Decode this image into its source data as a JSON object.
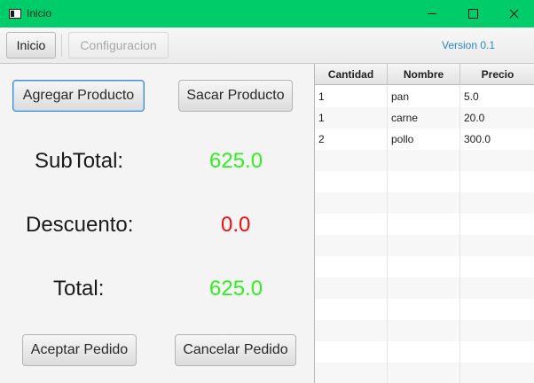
{
  "window": {
    "title": "Inicio",
    "icons": {
      "app": "window-icon",
      "minimize": "minimize-icon",
      "maximize": "maximize-icon",
      "close": "close-icon"
    },
    "title_bar_color": "#00cc6a"
  },
  "toolbar": {
    "inicio_label": "Inicio",
    "configuracion_label": "Configuracion",
    "version": "Version 0.1"
  },
  "actions": {
    "agregar": "Agregar Producto",
    "sacar": "Sacar Producto",
    "aceptar": "Aceptar Pedido",
    "cancelar": "Cancelar Pedido"
  },
  "summary": {
    "subtotal_label": "SubTotal:",
    "subtotal_value": "625.0",
    "descuento_label": "Descuento:",
    "descuento_value": "0.0",
    "total_label": "Total:",
    "total_value": "625.0",
    "colors": {
      "positive": "#33ee22",
      "discount": "#ee1111"
    }
  },
  "table": {
    "columns": [
      "Cantidad",
      "Nombre",
      "Precio"
    ],
    "rows": [
      [
        "1",
        "pan",
        "5.0"
      ],
      [
        "1",
        "carne",
        "20.0"
      ],
      [
        "2",
        "pollo",
        "300.0"
      ],
      [
        "",
        "",
        ""
      ],
      [
        "",
        "",
        ""
      ],
      [
        "",
        "",
        ""
      ],
      [
        "",
        "",
        ""
      ],
      [
        "",
        "",
        ""
      ],
      [
        "",
        "",
        ""
      ],
      [
        "",
        "",
        ""
      ],
      [
        "",
        "",
        ""
      ],
      [
        "",
        "",
        ""
      ],
      [
        "",
        "",
        ""
      ],
      [
        "",
        "",
        ""
      ]
    ]
  }
}
